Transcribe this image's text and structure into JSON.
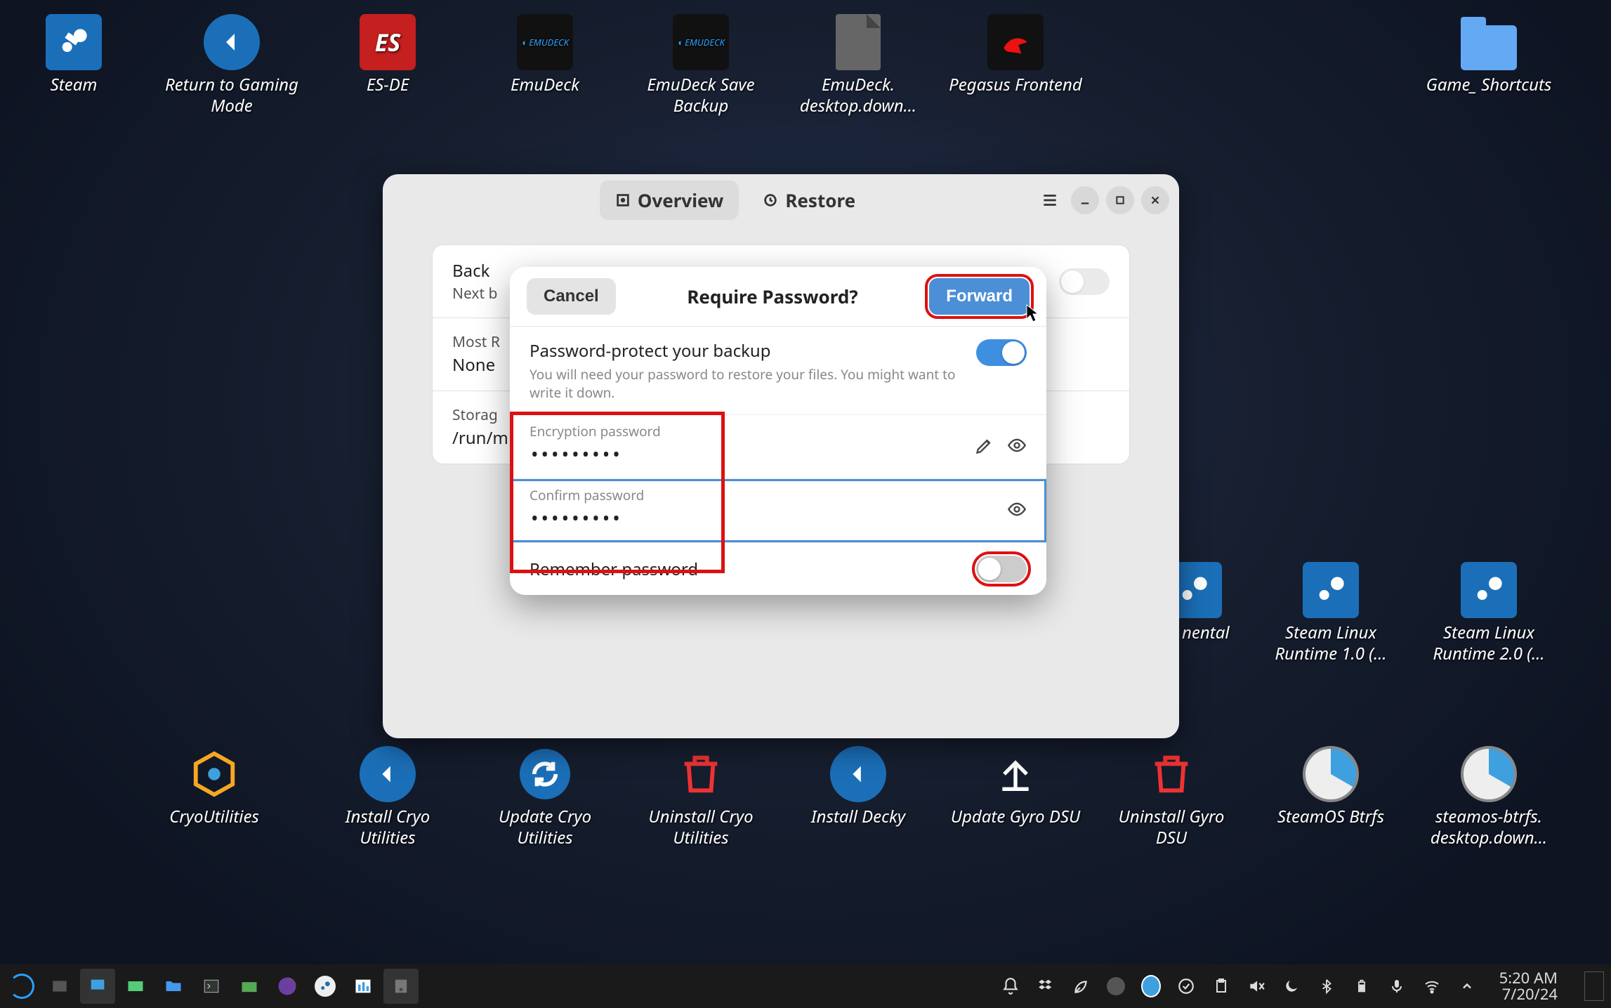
{
  "desktop_icons": {
    "steam": "Steam",
    "return_gaming": "Return to Gaming Mode",
    "esde": "ES-DE",
    "emudeck": "EmuDeck",
    "emudeck_save": "EmuDeck Save Backup",
    "emudeck_down": "EmuDeck. desktop.down…",
    "pegasus": "Pegasus Frontend",
    "game_shortcuts": "Game_ Shortcuts",
    "hidden_on": "on nental",
    "steam_rt1": "Steam Linux Runtime 1.0 (…",
    "steam_rt2": "Steam Linux Runtime 2.0 (…",
    "cryoutils": "CryoUtilities",
    "install_cryo": "Install Cryo Utilities",
    "update_cryo": "Update Cryo Utilities",
    "uninstall_cryo": "Uninstall Cryo Utilities",
    "install_decky": "Install Decky",
    "update_gyro": "Update Gyro DSU",
    "uninstall_gyro": "Uninstall Gyro DSU",
    "steamos_btrfs": "SteamOS Btrfs",
    "steamos_btrfs_down": "steamos-btrfs. desktop.down…"
  },
  "window": {
    "tabs": {
      "overview": "Overview",
      "restore": "Restore"
    },
    "rows": {
      "back_label": "Back",
      "back_sub": "Next b",
      "recent_label": "Most R",
      "recent_value": "None",
      "storage_label": "Storag",
      "storage_value": "/run/m"
    }
  },
  "modal": {
    "cancel": "Cancel",
    "title": "Require Password?",
    "forward": "Forward",
    "section_title": "Password-protect your backup",
    "section_sub": "You will need your password to restore your files. You might want to write it down.",
    "enc_label": "Encryption password",
    "enc_value": "•••••••••",
    "conf_label": "Confirm password",
    "conf_value": "•••••••••",
    "remember": "Remember password"
  },
  "panel": {
    "time": "5:20 AM",
    "date": "7/20/24"
  },
  "colors": {
    "accent": "#4c8fd6",
    "highlight": "#d11"
  }
}
